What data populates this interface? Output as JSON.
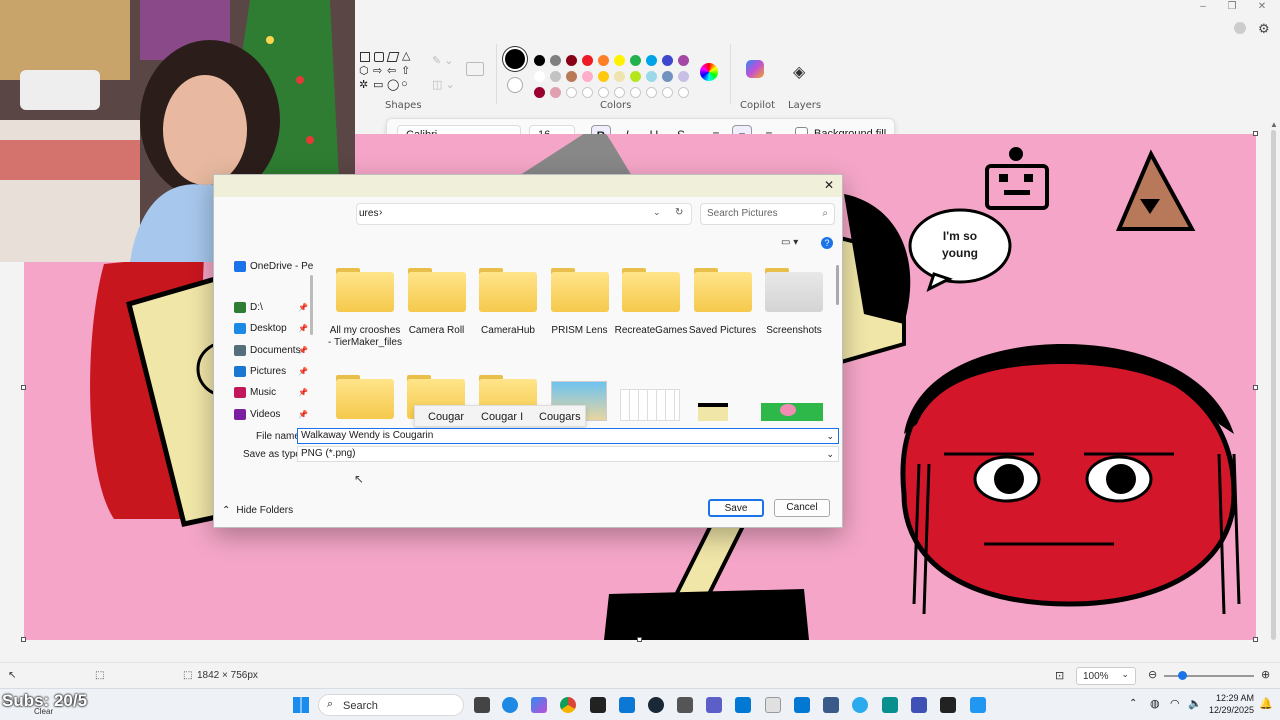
{
  "ribbon": {
    "shapes_label": "Shapes",
    "colors_label": "Colors",
    "copilot_label": "Copilot",
    "layers_label": "Layers",
    "window_controls": [
      "–",
      "❐",
      "✕"
    ],
    "settings_icon": "gear-icon",
    "palette": {
      "primary": "#000000",
      "secondary": "#ffffff",
      "row1": [
        "#000000",
        "#7f7f7f",
        "#880015",
        "#ed1c24",
        "#ff7f27",
        "#fff200",
        "#22b14c",
        "#00a2e8",
        "#3f48cc",
        "#a349a4"
      ],
      "row2": [
        "#ffffff",
        "#c3c3c3",
        "#b97a57",
        "#ffaec9",
        "#ffc90e",
        "#efe4b0",
        "#b5e61d",
        "#99d9ea",
        "#7092be",
        "#c8bfe7"
      ],
      "row3": [
        "#990030",
        "#e0a0b0"
      ]
    }
  },
  "text_toolbar": {
    "font": "Calibri",
    "size": "16",
    "bold": "B",
    "italic": "I",
    "underline": "U",
    "strike": "S",
    "background_fill_label": "Background fill"
  },
  "canvas": {
    "speech_bubble": [
      "I'm so",
      "young"
    ],
    "colors": {
      "pink": "#f5a6c8",
      "red": "#d4162a",
      "black": "#000000",
      "cream": "#f0e6a8"
    }
  },
  "dialog": {
    "breadcrumb": "ures",
    "search_placeholder": "Search Pictures",
    "nav": [
      {
        "label": "OneDrive - Pe",
        "icon": "cloud-icon"
      },
      {
        "label": "D:\\",
        "icon": "download-icon"
      },
      {
        "label": "Desktop",
        "icon": "desktop-icon"
      },
      {
        "label": "Documents",
        "icon": "documents-icon"
      },
      {
        "label": "Pictures",
        "icon": "pictures-icon"
      },
      {
        "label": "Music",
        "icon": "music-icon"
      },
      {
        "label": "Videos",
        "icon": "videos-icon"
      }
    ],
    "folders": [
      "All my crooshes - TierMaker_files",
      "Camera Roll",
      "CameraHub",
      "PRISM Lens",
      "RecreateGames",
      "Saved Pictures",
      "Screenshots"
    ],
    "autocomplete": [
      "Cougar",
      "Cougar I",
      "Cougars"
    ],
    "file_name_label": "File name:",
    "file_name_value": "Walkaway Wendy is Cougarin",
    "save_type_label": "Save as type:",
    "save_type_value": "PNG (*.png)",
    "hide_folders": "Hide Folders",
    "save": "Save",
    "cancel": "Cancel"
  },
  "statusbar": {
    "dimensions": "1842 × 756px",
    "zoom": "100%"
  },
  "taskbar": {
    "search": "Search",
    "time": "12:29 AM",
    "date": "12/29/2025",
    "overlay_text": "Subs: 20/5",
    "weather": "Clear"
  }
}
